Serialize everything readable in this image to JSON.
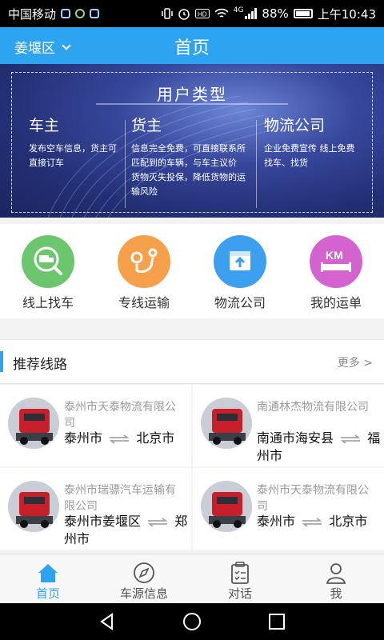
{
  "status_bar": {
    "carrier": "中国移动",
    "network": "4G",
    "battery": "88%",
    "time": "上午10:43"
  },
  "header": {
    "location": "姜堰区",
    "title": "首页"
  },
  "banner": {
    "title": "用户类型",
    "columns": [
      {
        "heading": "车主",
        "text": "发布空车信息，货主可直接订车"
      },
      {
        "heading": "货主",
        "text": "信息完全免费，可直接联系所匹配到的车辆，与车主议价 货物灭失投保，降低货物的运输风险"
      },
      {
        "heading": "物流公司",
        "text": "企业免费宣传 线上免费找车、找货"
      }
    ]
  },
  "categories": [
    {
      "label": "线上找车",
      "icon": "find-truck-icon",
      "color": "#6cc66d"
    },
    {
      "label": "专线运输",
      "icon": "route-icon",
      "color": "#f7a04c"
    },
    {
      "label": "物流公司",
      "icon": "logistics-box-icon",
      "color": "#3d9ff0"
    },
    {
      "label": "我的运单",
      "icon": "km-waybill-icon",
      "color": "#d462cf"
    }
  ],
  "recommended": {
    "title": "推荐线路",
    "more": "更多 >",
    "routes": [
      {
        "company": "泰州市天泰物流有限公司",
        "from": "泰州市",
        "to": "北京市"
      },
      {
        "company": "南通林杰物流有限公司",
        "from": "南通市海安县",
        "to": "福州市"
      },
      {
        "company": "泰州市瑞骠汽车运输有限公司",
        "from": "泰州市姜堰区",
        "to": "郑州市"
      },
      {
        "company": "泰州市天泰物流有限公司",
        "from": "泰州市",
        "to": "北京市"
      }
    ]
  },
  "tabs": [
    {
      "label": "首页",
      "icon": "home-icon",
      "active": true
    },
    {
      "label": "车源信息",
      "icon": "compass-icon",
      "active": false
    },
    {
      "label": "对话",
      "icon": "clipboard-icon",
      "active": false
    },
    {
      "label": "我",
      "icon": "person-icon",
      "active": false
    }
  ],
  "colors": {
    "primary": "#2ea3ef",
    "banner_bg": "#2b3a86"
  }
}
